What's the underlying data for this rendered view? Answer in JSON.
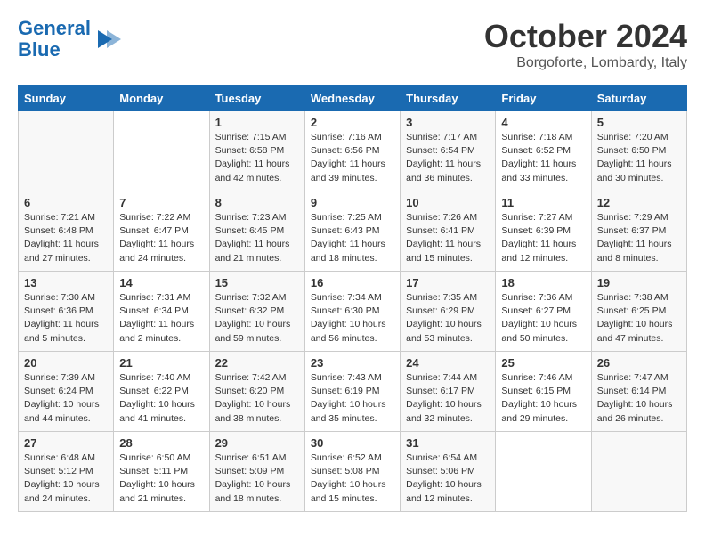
{
  "header": {
    "logo_line1": "General",
    "logo_line2": "Blue",
    "month": "October 2024",
    "location": "Borgoforte, Lombardy, Italy"
  },
  "weekdays": [
    "Sunday",
    "Monday",
    "Tuesday",
    "Wednesday",
    "Thursday",
    "Friday",
    "Saturday"
  ],
  "weeks": [
    [
      {
        "day": "",
        "info": ""
      },
      {
        "day": "",
        "info": ""
      },
      {
        "day": "1",
        "info": "Sunrise: 7:15 AM\nSunset: 6:58 PM\nDaylight: 11 hours and 42 minutes."
      },
      {
        "day": "2",
        "info": "Sunrise: 7:16 AM\nSunset: 6:56 PM\nDaylight: 11 hours and 39 minutes."
      },
      {
        "day": "3",
        "info": "Sunrise: 7:17 AM\nSunset: 6:54 PM\nDaylight: 11 hours and 36 minutes."
      },
      {
        "day": "4",
        "info": "Sunrise: 7:18 AM\nSunset: 6:52 PM\nDaylight: 11 hours and 33 minutes."
      },
      {
        "day": "5",
        "info": "Sunrise: 7:20 AM\nSunset: 6:50 PM\nDaylight: 11 hours and 30 minutes."
      }
    ],
    [
      {
        "day": "6",
        "info": "Sunrise: 7:21 AM\nSunset: 6:48 PM\nDaylight: 11 hours and 27 minutes."
      },
      {
        "day": "7",
        "info": "Sunrise: 7:22 AM\nSunset: 6:47 PM\nDaylight: 11 hours and 24 minutes."
      },
      {
        "day": "8",
        "info": "Sunrise: 7:23 AM\nSunset: 6:45 PM\nDaylight: 11 hours and 21 minutes."
      },
      {
        "day": "9",
        "info": "Sunrise: 7:25 AM\nSunset: 6:43 PM\nDaylight: 11 hours and 18 minutes."
      },
      {
        "day": "10",
        "info": "Sunrise: 7:26 AM\nSunset: 6:41 PM\nDaylight: 11 hours and 15 minutes."
      },
      {
        "day": "11",
        "info": "Sunrise: 7:27 AM\nSunset: 6:39 PM\nDaylight: 11 hours and 12 minutes."
      },
      {
        "day": "12",
        "info": "Sunrise: 7:29 AM\nSunset: 6:37 PM\nDaylight: 11 hours and 8 minutes."
      }
    ],
    [
      {
        "day": "13",
        "info": "Sunrise: 7:30 AM\nSunset: 6:36 PM\nDaylight: 11 hours and 5 minutes."
      },
      {
        "day": "14",
        "info": "Sunrise: 7:31 AM\nSunset: 6:34 PM\nDaylight: 11 hours and 2 minutes."
      },
      {
        "day": "15",
        "info": "Sunrise: 7:32 AM\nSunset: 6:32 PM\nDaylight: 10 hours and 59 minutes."
      },
      {
        "day": "16",
        "info": "Sunrise: 7:34 AM\nSunset: 6:30 PM\nDaylight: 10 hours and 56 minutes."
      },
      {
        "day": "17",
        "info": "Sunrise: 7:35 AM\nSunset: 6:29 PM\nDaylight: 10 hours and 53 minutes."
      },
      {
        "day": "18",
        "info": "Sunrise: 7:36 AM\nSunset: 6:27 PM\nDaylight: 10 hours and 50 minutes."
      },
      {
        "day": "19",
        "info": "Sunrise: 7:38 AM\nSunset: 6:25 PM\nDaylight: 10 hours and 47 minutes."
      }
    ],
    [
      {
        "day": "20",
        "info": "Sunrise: 7:39 AM\nSunset: 6:24 PM\nDaylight: 10 hours and 44 minutes."
      },
      {
        "day": "21",
        "info": "Sunrise: 7:40 AM\nSunset: 6:22 PM\nDaylight: 10 hours and 41 minutes."
      },
      {
        "day": "22",
        "info": "Sunrise: 7:42 AM\nSunset: 6:20 PM\nDaylight: 10 hours and 38 minutes."
      },
      {
        "day": "23",
        "info": "Sunrise: 7:43 AM\nSunset: 6:19 PM\nDaylight: 10 hours and 35 minutes."
      },
      {
        "day": "24",
        "info": "Sunrise: 7:44 AM\nSunset: 6:17 PM\nDaylight: 10 hours and 32 minutes."
      },
      {
        "day": "25",
        "info": "Sunrise: 7:46 AM\nSunset: 6:15 PM\nDaylight: 10 hours and 29 minutes."
      },
      {
        "day": "26",
        "info": "Sunrise: 7:47 AM\nSunset: 6:14 PM\nDaylight: 10 hours and 26 minutes."
      }
    ],
    [
      {
        "day": "27",
        "info": "Sunrise: 6:48 AM\nSunset: 5:12 PM\nDaylight: 10 hours and 24 minutes."
      },
      {
        "day": "28",
        "info": "Sunrise: 6:50 AM\nSunset: 5:11 PM\nDaylight: 10 hours and 21 minutes."
      },
      {
        "day": "29",
        "info": "Sunrise: 6:51 AM\nSunset: 5:09 PM\nDaylight: 10 hours and 18 minutes."
      },
      {
        "day": "30",
        "info": "Sunrise: 6:52 AM\nSunset: 5:08 PM\nDaylight: 10 hours and 15 minutes."
      },
      {
        "day": "31",
        "info": "Sunrise: 6:54 AM\nSunset: 5:06 PM\nDaylight: 10 hours and 12 minutes."
      },
      {
        "day": "",
        "info": ""
      },
      {
        "day": "",
        "info": ""
      }
    ]
  ]
}
